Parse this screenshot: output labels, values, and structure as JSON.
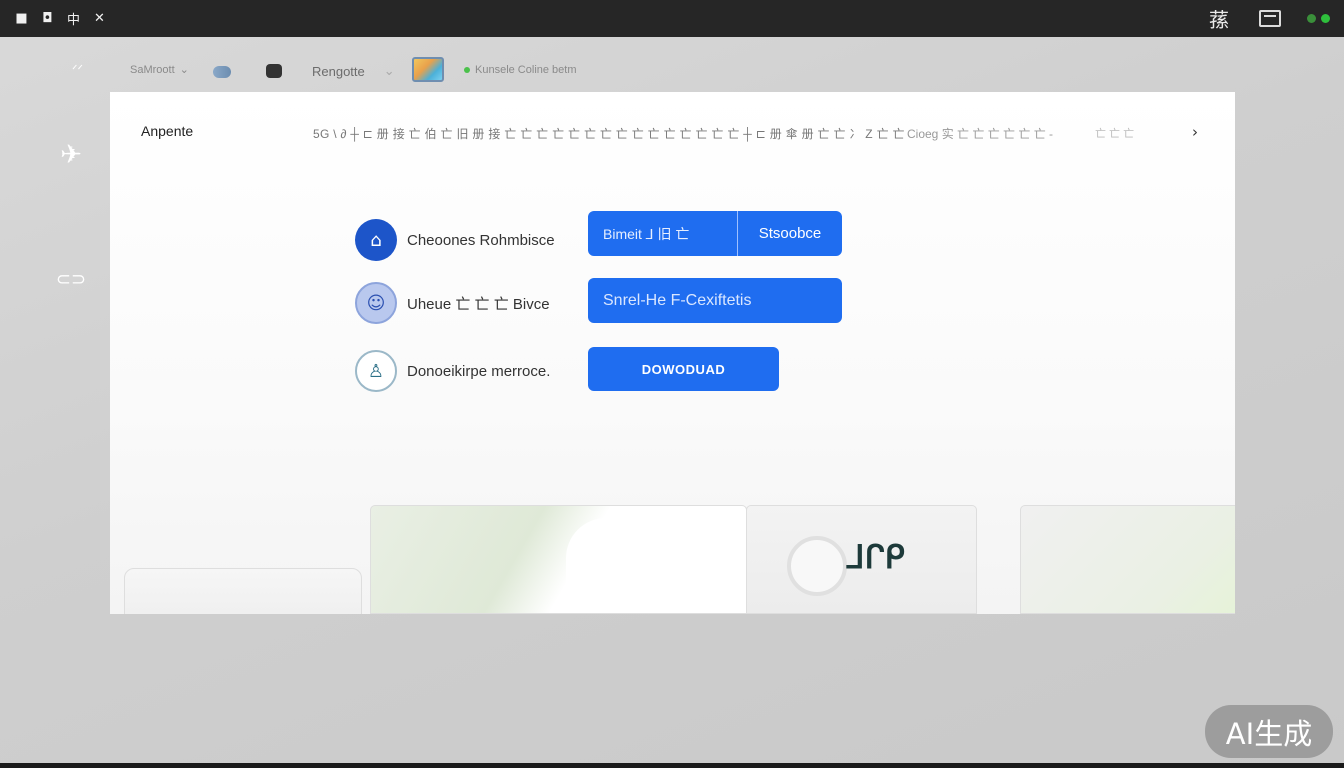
{
  "topbar": {
    "left_icons": [
      "app-icon",
      "window-icon",
      "language-icon",
      "close-icon"
    ],
    "language_glyph": "中",
    "close_glyph": "✕",
    "right_glyph": "蓀"
  },
  "toolbar": {
    "item1": "SaMroott",
    "item2": "Rengotte",
    "item3": "Kunsele Coline betm"
  },
  "card": {
    "title": "Anpente",
    "description": "5G \\ ∂ ┼ ⊏ 册 接 亡 伯 亡 旧 册 接 亡 亡 亡 亡 亡 亡 亡 亡 亡 亡 亡 亡 亡 亡 亡 ┼ ⊏ 册 傘 册 亡 亡 冫 Z 亡 亡",
    "description2": "Cioeg 实 亡 亡 亡 亡 亡 亡 -",
    "description3": "亡 亡 亡",
    "chevron": "›"
  },
  "rows": [
    {
      "icon": "building-icon",
      "label": "Cheoones Rohmbisce"
    },
    {
      "icon": "robot-icon",
      "label": "Uheue 亡 亡 亡 Bivce"
    },
    {
      "icon": "person-icon",
      "label": "Donoeikirpe merroce."
    }
  ],
  "buttons": {
    "split_left": "Bimeit   ⅃ 旧 亡",
    "split_right": "Stsoobce",
    "wide": "Snrel-He F-Cexiftetis",
    "download": "DOWODUAD"
  },
  "thumbnails": {
    "logo_text": "ᒧᒋᑭ"
  },
  "badge": "AI生成"
}
